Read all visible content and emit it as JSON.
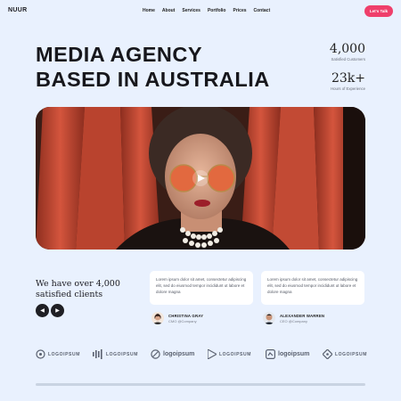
{
  "brand": {
    "name": "NUUR",
    "accent": "#ef3f6b"
  },
  "nav": {
    "items": [
      "Home",
      "About",
      "Services",
      "Portfolio",
      "Prices",
      "Contact"
    ],
    "cta_label": "Let's Talk"
  },
  "hero": {
    "title_line1": "MEDIA AGENCY",
    "title_line2": "BASED IN AUSTRALIA",
    "stats": [
      {
        "value": "4,000",
        "label": "Satisfied Customers"
      },
      {
        "value": "23k+",
        "label": "Hours of Experience"
      }
    ]
  },
  "testimonials": {
    "heading": "We have over 4,000 satisfied clients",
    "cards": [
      {
        "text": "Lorem ipsum dolor sit amet, consectetur adipiscing elit, sed do eiusmod tempor incididunt ut labore et dolore magna",
        "name": "CHRISTINA GRAY",
        "role": "CMO @Company"
      },
      {
        "text": "Lorem ipsum dolor sit amet, consectetur adipiscing elit, sed do eiusmod tempor incididunt ut labore et dolore magna",
        "name": "ALEXANDER WARREN",
        "role": "CEO @Company"
      }
    ]
  },
  "logos": [
    "LOGOIPSUM",
    "LOGOIPSUM",
    "logoipsum",
    "LOGOIPSUM",
    "logoipsum",
    "LOGOIPSUM"
  ],
  "icons": [
    "left-arrow-icon",
    "right-arrow-icon",
    "play-icon"
  ]
}
